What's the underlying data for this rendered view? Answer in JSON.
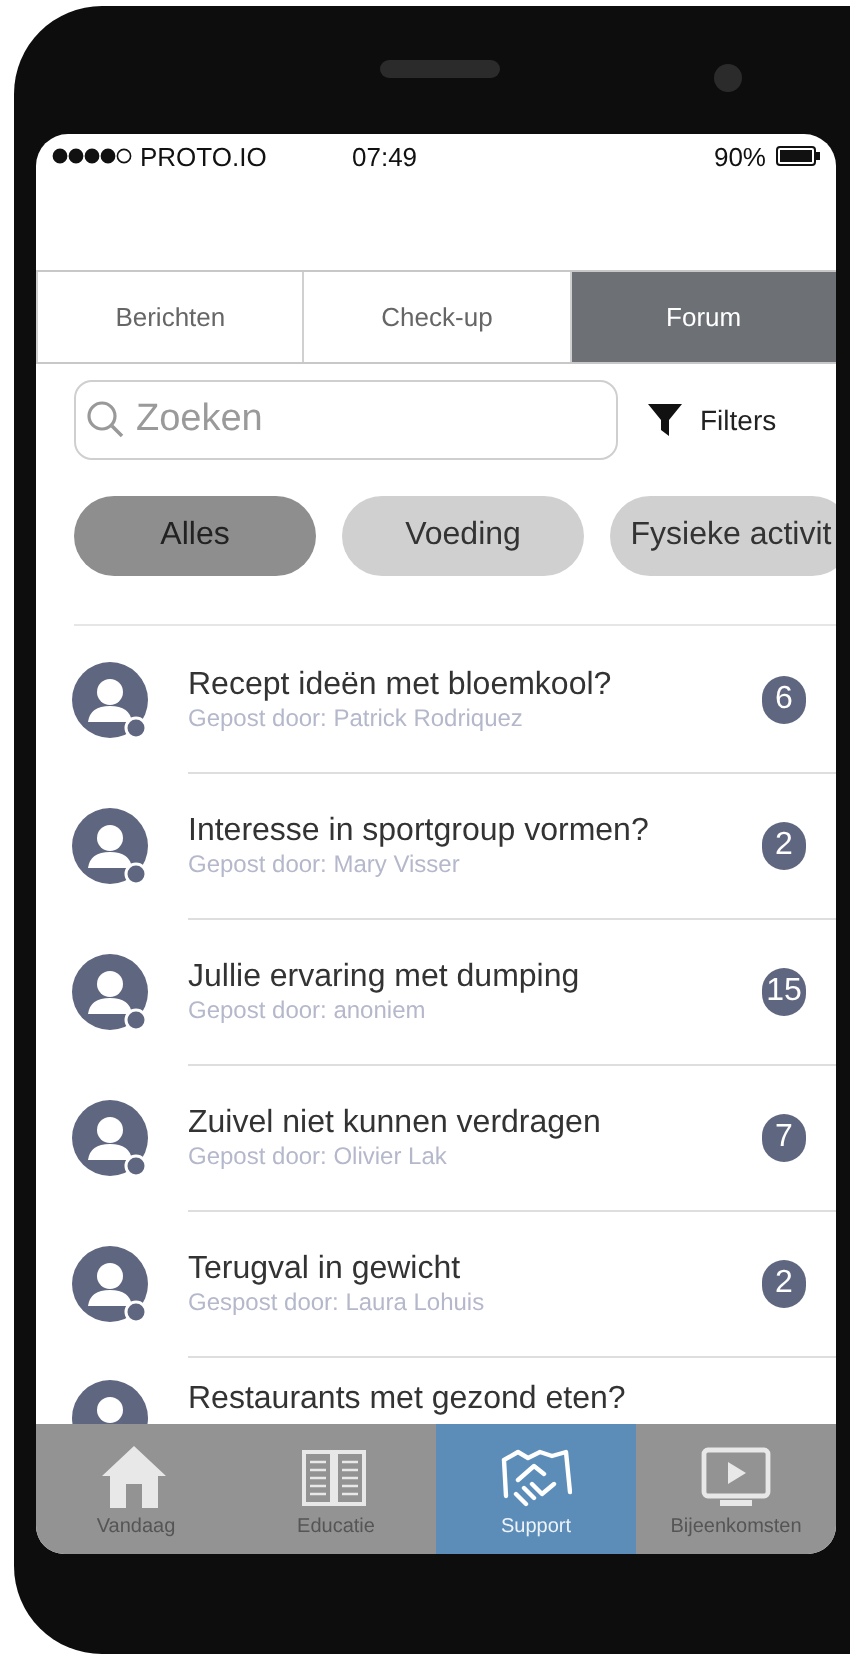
{
  "status_bar": {
    "carrier": "PROTO.IO",
    "time": "07:49",
    "battery": "90%"
  },
  "tabs": [
    {
      "label": "Berichten",
      "selected": false
    },
    {
      "label": "Check-up",
      "selected": false
    },
    {
      "label": "Forum",
      "selected": true
    }
  ],
  "search": {
    "placeholder": "Zoeken"
  },
  "filter_button": {
    "label": "Filters"
  },
  "categories": [
    {
      "label": "Alles",
      "selected": true
    },
    {
      "label": "Voeding",
      "selected": false
    },
    {
      "label": "Fysieke activit",
      "selected": false
    }
  ],
  "threads": [
    {
      "title": "Recept ideën met bloemkool?",
      "author": "Gepost door: Patrick Rodriquez",
      "count": "6"
    },
    {
      "title": "Interesse in sportgroup vormen?",
      "author": "Gepost door: Mary Visser",
      "count": "2"
    },
    {
      "title": "Jullie ervaring met dumping",
      "author": "Gepost door: anoniem",
      "count": "15"
    },
    {
      "title": "Zuivel niet kunnen verdragen",
      "author": "Gepost door: Olivier Lak",
      "count": "7"
    },
    {
      "title": "Terugval in gewicht",
      "author": "Gespost door: Laura Lohuis",
      "count": "2"
    },
    {
      "title": "Restaurants met gezond eten?"
    }
  ],
  "nav": [
    {
      "label": "Vandaag",
      "selected": false
    },
    {
      "label": "Educatie",
      "selected": false
    },
    {
      "label": "Support",
      "selected": true
    },
    {
      "label": "Bijeenkomsten",
      "selected": false
    }
  ]
}
